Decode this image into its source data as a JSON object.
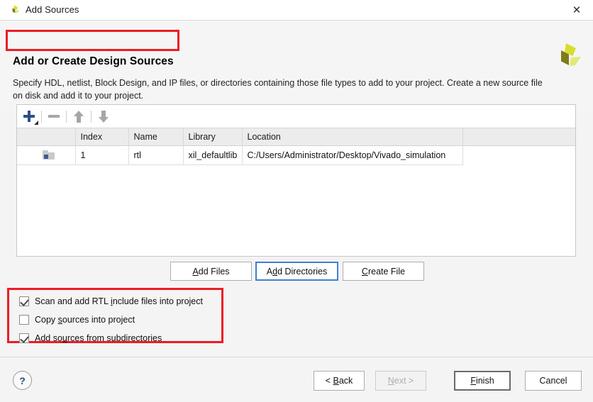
{
  "window": {
    "title": "Add Sources",
    "logo_icon": "xilinx-logo-icon",
    "close_icon": "close-icon"
  },
  "header": {
    "page_title": "Add or Create Design Sources",
    "description": "Specify HDL, netlist, Block Design, and IP files, or directories containing those file types to add to your project. Create a new source file on disk and add it to your project.",
    "logo_icon": "xilinx-logo-icon"
  },
  "toolbar": {
    "add_icon": "plus-icon",
    "remove_icon": "minus-icon",
    "move_up_icon": "arrow-up-icon",
    "move_down_icon": "arrow-down-icon"
  },
  "table": {
    "columns": [
      "",
      "Index",
      "Name",
      "Library",
      "Location",
      ""
    ],
    "rows": [
      {
        "icon": "folder-icon",
        "index": "1",
        "name": "rtl",
        "library": "xil_defaultlib",
        "location": "C:/Users/Administrator/Desktop/Vivado_simulation"
      }
    ]
  },
  "actions": {
    "add_files": {
      "prefix": "",
      "accel": "A",
      "suffix": "dd Files"
    },
    "add_directories": {
      "prefix": "A",
      "accel": "d",
      "suffix": "d Directories"
    },
    "create_file": {
      "prefix": "",
      "accel": "C",
      "suffix": "reate File"
    }
  },
  "options": [
    {
      "label_pre": "Scan and add RTL ",
      "accel": "i",
      "label_post": "nclude files into project",
      "checked": true
    },
    {
      "label_pre": "Copy ",
      "accel": "s",
      "label_post": "ources into project",
      "checked": false
    },
    {
      "label_pre": "Add so",
      "accel": "u",
      "label_post": "rces from subdirectories",
      "checked": true
    }
  ],
  "footer": {
    "help_icon": "help-icon",
    "help_label": "?",
    "back": {
      "pre": "< ",
      "accel": "B",
      "post": "ack",
      "enabled": true
    },
    "next": {
      "pre": "",
      "accel": "N",
      "post": "ext >",
      "enabled": false
    },
    "finish": {
      "pre": "",
      "accel": "F",
      "post": "inish",
      "enabled": true,
      "is_default": true
    },
    "cancel": {
      "pre": "",
      "accel": "",
      "post": "Cancel",
      "enabled": true
    }
  },
  "annotations": {
    "highlight_color": "#ed1c24",
    "boxes": [
      "page-title-highlight",
      "options-highlight"
    ]
  },
  "colors": {
    "accent_blue": "#2c4e8a",
    "focus_blue": "#3f7fd0",
    "logo_green": "#d6de30",
    "logo_olive": "#7d7b1a"
  }
}
